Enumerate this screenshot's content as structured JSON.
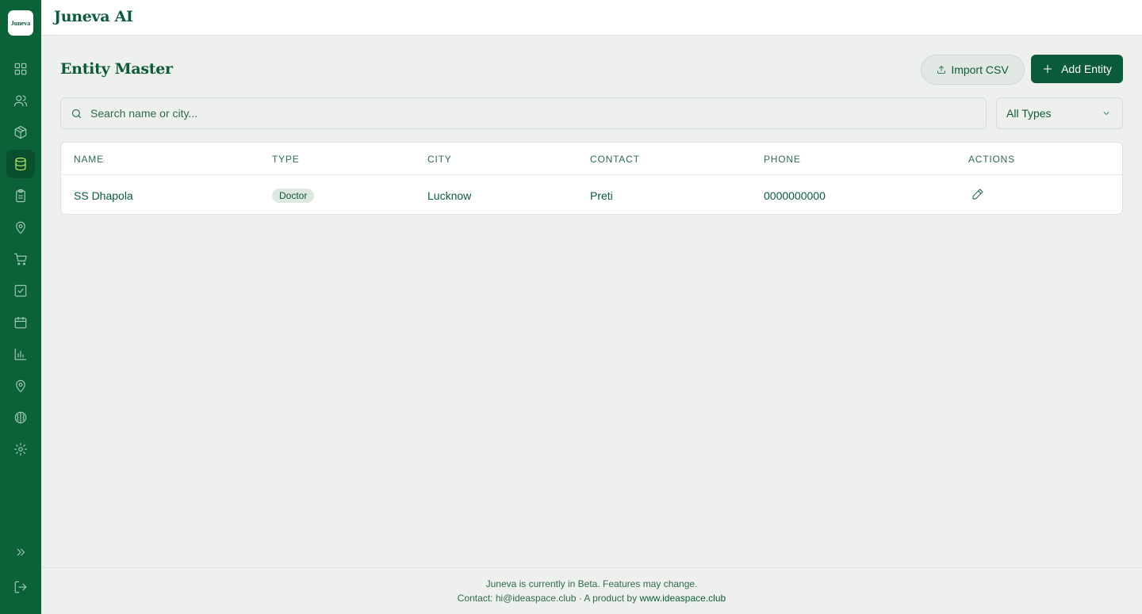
{
  "app": {
    "logo_text": "Juneva",
    "title": "Juneva AI"
  },
  "sidebar": {
    "items": [
      {
        "icon": "dashboard-icon",
        "active": false
      },
      {
        "icon": "users-icon",
        "active": false
      },
      {
        "icon": "package-icon",
        "active": false
      },
      {
        "icon": "database-icon",
        "active": true
      },
      {
        "icon": "clipboard-icon",
        "active": false
      },
      {
        "icon": "map-pin-icon",
        "active": false
      },
      {
        "icon": "cart-icon",
        "active": false
      },
      {
        "icon": "checkbox-icon",
        "active": false
      },
      {
        "icon": "calendar-icon",
        "active": false
      },
      {
        "icon": "bar-chart-icon",
        "active": false
      },
      {
        "icon": "location-icon",
        "active": false
      },
      {
        "icon": "brain-icon",
        "active": false
      },
      {
        "icon": "gear-icon",
        "active": false
      }
    ],
    "bottom": [
      {
        "icon": "expand-icon"
      },
      {
        "icon": "logout-icon"
      }
    ]
  },
  "page": {
    "title": "Entity Master",
    "import_label": "Import CSV",
    "add_label": "Add Entity"
  },
  "filters": {
    "search_placeholder": "Search name or city...",
    "type_value": "All Types"
  },
  "table": {
    "columns": [
      "NAME",
      "TYPE",
      "CITY",
      "CONTACT",
      "PHONE",
      "ACTIONS"
    ],
    "rows": [
      {
        "name": "SS Dhapola",
        "type": "Doctor",
        "city": "Lucknow",
        "contact": "Preti",
        "phone": "0000000000"
      }
    ]
  },
  "footer": {
    "line1": "Juneva is currently in Beta. Features may change.",
    "contact": "Contact: hi@ideaspace.club · A product by ",
    "link": "www.ideaspace.club"
  },
  "colors": {
    "brand": "#0b6238",
    "accent": "#c6f26b",
    "background": "#eef0ee"
  }
}
